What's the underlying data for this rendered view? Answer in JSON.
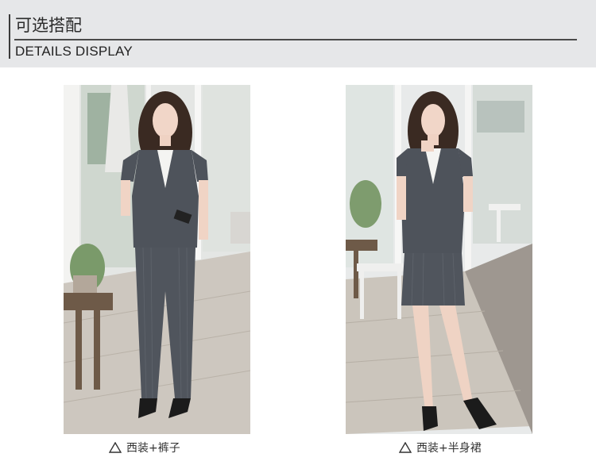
{
  "header": {
    "title_zh": "可选搭配",
    "title_en": "DETAILS DISPLAY"
  },
  "products": [
    {
      "caption": "西装+裤子",
      "icon": "triangle-outline-icon"
    },
    {
      "caption": "西装+半身裙",
      "icon": "triangle-outline-icon"
    }
  ],
  "colors": {
    "banner_bg": "#e6e7e9",
    "suit_gray": "#4e535b",
    "floor": "#c9c3bb"
  }
}
